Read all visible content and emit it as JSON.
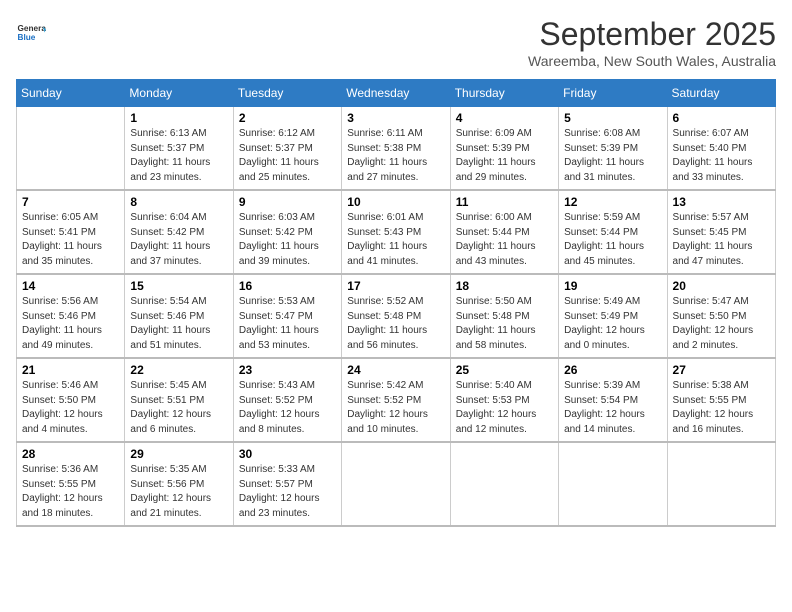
{
  "header": {
    "logo_general": "General",
    "logo_blue": "Blue",
    "month_title": "September 2025",
    "location": "Wareemba, New South Wales, Australia"
  },
  "days_of_week": [
    "Sunday",
    "Monday",
    "Tuesday",
    "Wednesday",
    "Thursday",
    "Friday",
    "Saturday"
  ],
  "weeks": [
    [
      {
        "day": "",
        "sunrise": "",
        "sunset": "",
        "daylight": ""
      },
      {
        "day": "1",
        "sunrise": "Sunrise: 6:13 AM",
        "sunset": "Sunset: 5:37 PM",
        "daylight": "Daylight: 11 hours and 23 minutes."
      },
      {
        "day": "2",
        "sunrise": "Sunrise: 6:12 AM",
        "sunset": "Sunset: 5:37 PM",
        "daylight": "Daylight: 11 hours and 25 minutes."
      },
      {
        "day": "3",
        "sunrise": "Sunrise: 6:11 AM",
        "sunset": "Sunset: 5:38 PM",
        "daylight": "Daylight: 11 hours and 27 minutes."
      },
      {
        "day": "4",
        "sunrise": "Sunrise: 6:09 AM",
        "sunset": "Sunset: 5:39 PM",
        "daylight": "Daylight: 11 hours and 29 minutes."
      },
      {
        "day": "5",
        "sunrise": "Sunrise: 6:08 AM",
        "sunset": "Sunset: 5:39 PM",
        "daylight": "Daylight: 11 hours and 31 minutes."
      },
      {
        "day": "6",
        "sunrise": "Sunrise: 6:07 AM",
        "sunset": "Sunset: 5:40 PM",
        "daylight": "Daylight: 11 hours and 33 minutes."
      }
    ],
    [
      {
        "day": "7",
        "sunrise": "Sunrise: 6:05 AM",
        "sunset": "Sunset: 5:41 PM",
        "daylight": "Daylight: 11 hours and 35 minutes."
      },
      {
        "day": "8",
        "sunrise": "Sunrise: 6:04 AM",
        "sunset": "Sunset: 5:42 PM",
        "daylight": "Daylight: 11 hours and 37 minutes."
      },
      {
        "day": "9",
        "sunrise": "Sunrise: 6:03 AM",
        "sunset": "Sunset: 5:42 PM",
        "daylight": "Daylight: 11 hours and 39 minutes."
      },
      {
        "day": "10",
        "sunrise": "Sunrise: 6:01 AM",
        "sunset": "Sunset: 5:43 PM",
        "daylight": "Daylight: 11 hours and 41 minutes."
      },
      {
        "day": "11",
        "sunrise": "Sunrise: 6:00 AM",
        "sunset": "Sunset: 5:44 PM",
        "daylight": "Daylight: 11 hours and 43 minutes."
      },
      {
        "day": "12",
        "sunrise": "Sunrise: 5:59 AM",
        "sunset": "Sunset: 5:44 PM",
        "daylight": "Daylight: 11 hours and 45 minutes."
      },
      {
        "day": "13",
        "sunrise": "Sunrise: 5:57 AM",
        "sunset": "Sunset: 5:45 PM",
        "daylight": "Daylight: 11 hours and 47 minutes."
      }
    ],
    [
      {
        "day": "14",
        "sunrise": "Sunrise: 5:56 AM",
        "sunset": "Sunset: 5:46 PM",
        "daylight": "Daylight: 11 hours and 49 minutes."
      },
      {
        "day": "15",
        "sunrise": "Sunrise: 5:54 AM",
        "sunset": "Sunset: 5:46 PM",
        "daylight": "Daylight: 11 hours and 51 minutes."
      },
      {
        "day": "16",
        "sunrise": "Sunrise: 5:53 AM",
        "sunset": "Sunset: 5:47 PM",
        "daylight": "Daylight: 11 hours and 53 minutes."
      },
      {
        "day": "17",
        "sunrise": "Sunrise: 5:52 AM",
        "sunset": "Sunset: 5:48 PM",
        "daylight": "Daylight: 11 hours and 56 minutes."
      },
      {
        "day": "18",
        "sunrise": "Sunrise: 5:50 AM",
        "sunset": "Sunset: 5:48 PM",
        "daylight": "Daylight: 11 hours and 58 minutes."
      },
      {
        "day": "19",
        "sunrise": "Sunrise: 5:49 AM",
        "sunset": "Sunset: 5:49 PM",
        "daylight": "Daylight: 12 hours and 0 minutes."
      },
      {
        "day": "20",
        "sunrise": "Sunrise: 5:47 AM",
        "sunset": "Sunset: 5:50 PM",
        "daylight": "Daylight: 12 hours and 2 minutes."
      }
    ],
    [
      {
        "day": "21",
        "sunrise": "Sunrise: 5:46 AM",
        "sunset": "Sunset: 5:50 PM",
        "daylight": "Daylight: 12 hours and 4 minutes."
      },
      {
        "day": "22",
        "sunrise": "Sunrise: 5:45 AM",
        "sunset": "Sunset: 5:51 PM",
        "daylight": "Daylight: 12 hours and 6 minutes."
      },
      {
        "day": "23",
        "sunrise": "Sunrise: 5:43 AM",
        "sunset": "Sunset: 5:52 PM",
        "daylight": "Daylight: 12 hours and 8 minutes."
      },
      {
        "day": "24",
        "sunrise": "Sunrise: 5:42 AM",
        "sunset": "Sunset: 5:52 PM",
        "daylight": "Daylight: 12 hours and 10 minutes."
      },
      {
        "day": "25",
        "sunrise": "Sunrise: 5:40 AM",
        "sunset": "Sunset: 5:53 PM",
        "daylight": "Daylight: 12 hours and 12 minutes."
      },
      {
        "day": "26",
        "sunrise": "Sunrise: 5:39 AM",
        "sunset": "Sunset: 5:54 PM",
        "daylight": "Daylight: 12 hours and 14 minutes."
      },
      {
        "day": "27",
        "sunrise": "Sunrise: 5:38 AM",
        "sunset": "Sunset: 5:55 PM",
        "daylight": "Daylight: 12 hours and 16 minutes."
      }
    ],
    [
      {
        "day": "28",
        "sunrise": "Sunrise: 5:36 AM",
        "sunset": "Sunset: 5:55 PM",
        "daylight": "Daylight: 12 hours and 18 minutes."
      },
      {
        "day": "29",
        "sunrise": "Sunrise: 5:35 AM",
        "sunset": "Sunset: 5:56 PM",
        "daylight": "Daylight: 12 hours and 21 minutes."
      },
      {
        "day": "30",
        "sunrise": "Sunrise: 5:33 AM",
        "sunset": "Sunset: 5:57 PM",
        "daylight": "Daylight: 12 hours and 23 minutes."
      },
      {
        "day": "",
        "sunrise": "",
        "sunset": "",
        "daylight": ""
      },
      {
        "day": "",
        "sunrise": "",
        "sunset": "",
        "daylight": ""
      },
      {
        "day": "",
        "sunrise": "",
        "sunset": "",
        "daylight": ""
      },
      {
        "day": "",
        "sunrise": "",
        "sunset": "",
        "daylight": ""
      }
    ]
  ]
}
